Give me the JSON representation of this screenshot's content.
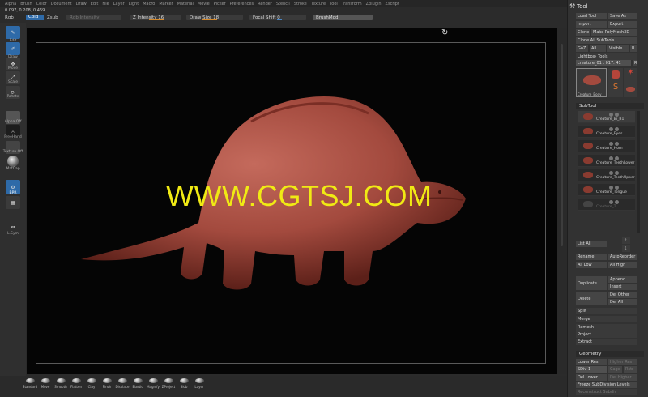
{
  "menu": [
    "Alpha",
    "Brush",
    "Color",
    "Document",
    "Draw",
    "Edit",
    "File",
    "Layer",
    "Light",
    "Macro",
    "Marker",
    "Material",
    "Movie",
    "Picker",
    "Preferences",
    "Render",
    "Stencil",
    "Stroke",
    "Texture",
    "Tool",
    "Transform",
    "Zplugin",
    "Zscript"
  ],
  "coords": "0.097, 0.208, 0.469",
  "toolbar": {
    "rgb": "Rgb",
    "mrgb": "Cold",
    "zadd": "Zsub",
    "rgb_intensity": "Rgb Intensity",
    "z_intensity": "Z Intensity 16",
    "draw_size": "Draw Size 18",
    "focal_shift": "Focal Shift 0",
    "brush_mod": "BrushMod"
  },
  "left_shelf": {
    "edit": "Edit",
    "draw": "Draw",
    "move": "Move",
    "scale": "Scale",
    "rotate": "Rotate",
    "alpha_off": "Alpha Off",
    "freehand": "FreeHand",
    "texture_off": "Texture Off",
    "matcap": "MatCap",
    "bpr": "BPR",
    "lsym": "L.Sym"
  },
  "watermark": "WWW.CGTSJ.COM",
  "brushes": [
    "Standard",
    "Move",
    "Smooth",
    "Flatten",
    "Clay",
    "Pinch",
    "Displace",
    "Elastic",
    "Magnify",
    "ZProject",
    "Blob",
    "Layer"
  ],
  "tool_panel": {
    "title": "Tool",
    "load_tool": "Load Tool",
    "save_as": "Save As",
    "import": "Import",
    "export": "Export",
    "clone": "Clone",
    "make_polymesh": "Make PolyMesh3D",
    "clone_all_subtools": "Clone All SubTools",
    "goz": "GoZ",
    "all": "All",
    "visible": "Visible",
    "r": "R",
    "lightbox_tools": "Lightbox› Tools",
    "current_tool": "creature_01 . 017. 41",
    "thumb_labels": [
      "Creature_Body",
      "Cylinder PolyMesh",
      "SimpleBrush",
      "Creature"
    ],
    "subtool_header": "SubTool",
    "subtools": [
      "Creature_Bi_B1",
      "Creature_Eyes",
      "Creature_Horn",
      "Creature_TeethLower",
      "Creature_TeethUpper",
      "Creature_Tongue",
      "Creature_T"
    ],
    "list_all": "List All",
    "rename": "Rename",
    "auto_reorder": "AutoReorder",
    "all_low": "All Low",
    "all_high": "All High",
    "duplicate": "Duplicate",
    "append": "Append",
    "insert": "Insert",
    "delete": "Delete",
    "del_other": "Del Other",
    "del_all": "Del All",
    "split": "Split",
    "merge": "Merge",
    "remesh": "Remesh",
    "project": "Project",
    "extract": "Extract",
    "geometry_header": "Geometry",
    "lower_res": "Lower Res",
    "higher_res": "Higher Res",
    "sdiv": "SDiv 1",
    "cage": "Cage",
    "rstr": "Rstr",
    "del_lower": "Del Lower",
    "del_higher": "Del Higher",
    "freeze_subdiv": "Freeze SubDivision Levels",
    "reconstruct": "Reconstruct Subdiv"
  },
  "colors": {
    "accent_blue": "#2e6aa8",
    "clay": "#a34a3e",
    "watermark": "#f0ea14",
    "slider_orange": "#d88a2a"
  }
}
